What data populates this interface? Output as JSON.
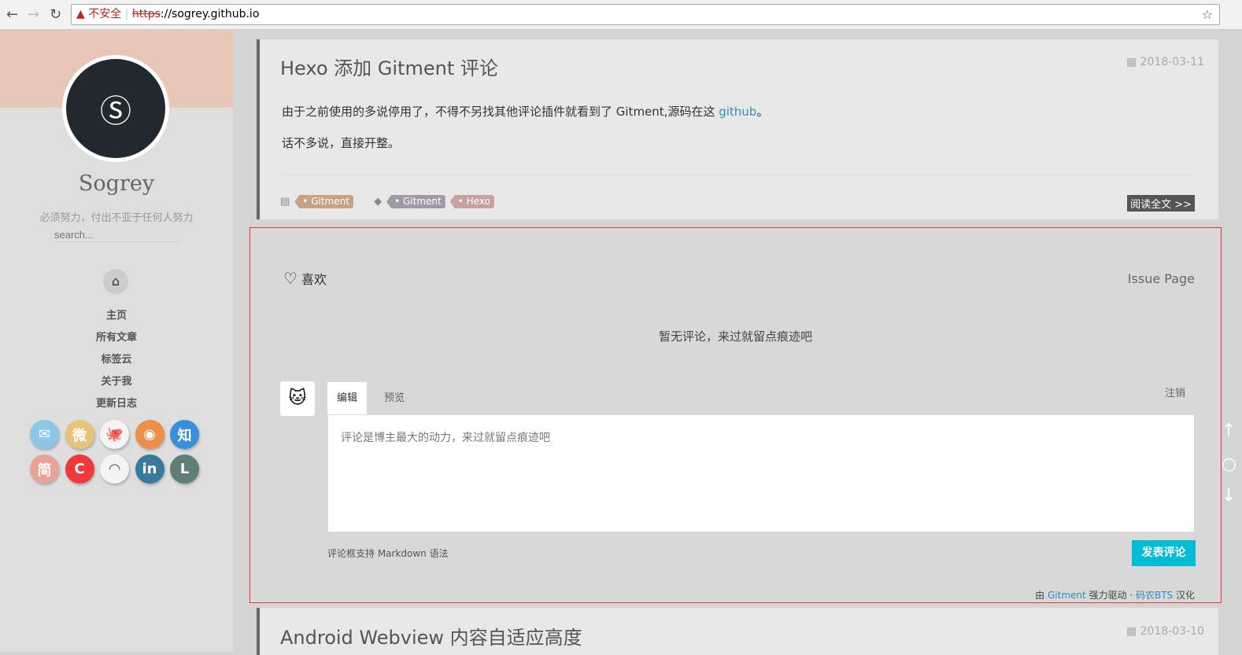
{
  "browser": {
    "warning": "不安全",
    "scheme": "https",
    "url_rest": "://sogrey.github.io"
  },
  "sidebar": {
    "name": "Sogrey",
    "motto": "必须努力，付出不亚于任何人努力",
    "search_placeholder": "search...",
    "menu": [
      "主页",
      "所有文章",
      "标签云",
      "关于我",
      "更新日志"
    ],
    "social": [
      {
        "icon": "mail-icon",
        "glyph": "✉",
        "color": "#8cc8e6"
      },
      {
        "icon": "weibo-icon",
        "glyph": "微",
        "color": "#e8c277"
      },
      {
        "icon": "github-icon",
        "glyph": "🐙",
        "color": "#f4f4f4"
      },
      {
        "icon": "rss-icon",
        "glyph": "◉",
        "color": "#ec8f4a"
      },
      {
        "icon": "zhihu-icon",
        "glyph": "知",
        "color": "#3a8fd9"
      },
      {
        "icon": "jianshu-icon",
        "glyph": "简",
        "color": "#e8a296"
      },
      {
        "icon": "csdn-icon",
        "glyph": "C",
        "color": "#f03a3a"
      },
      {
        "icon": "segmentfault-icon",
        "glyph": "◠",
        "color": "#f4f4f4"
      },
      {
        "icon": "linkedin-icon",
        "glyph": "in",
        "color": "#367a9c"
      },
      {
        "icon": "l-icon",
        "glyph": "L",
        "color": "#5e7e78"
      }
    ]
  },
  "post1": {
    "title": "Hexo 添加 Gitment 评论",
    "date": "2018-03-11",
    "text1": "由于之前使用的多说停用了，不得不另找其他评论插件就看到了 Gitment,源码在这 ",
    "link": "github",
    "text1_end": "。",
    "text2": "话不多说，直接开整。",
    "category": "Gitment",
    "tags": [
      "Gitment",
      "Hexo"
    ],
    "read_more": "阅读全文 >>"
  },
  "gitment": {
    "like": "喜欢",
    "issue_page": "Issue Page",
    "empty": "暂无评论，来过就留点痕迹吧",
    "tab_edit": "编辑",
    "tab_preview": "预览",
    "logout": "注销",
    "placeholder": "评论是博主最大的动力，来过就留点痕迹吧",
    "markdown_hint": "评论框支持 Markdown 语法",
    "submit": "发表评论",
    "footer_by": "由 ",
    "footer_gitment": "Gitment",
    "footer_mid": " 强力驱动 · ",
    "footer_bts": "码农BTS",
    "footer_end": " 汉化"
  },
  "post2": {
    "title": "Android Webview 内容自适应高度",
    "date": "2018-03-10"
  }
}
